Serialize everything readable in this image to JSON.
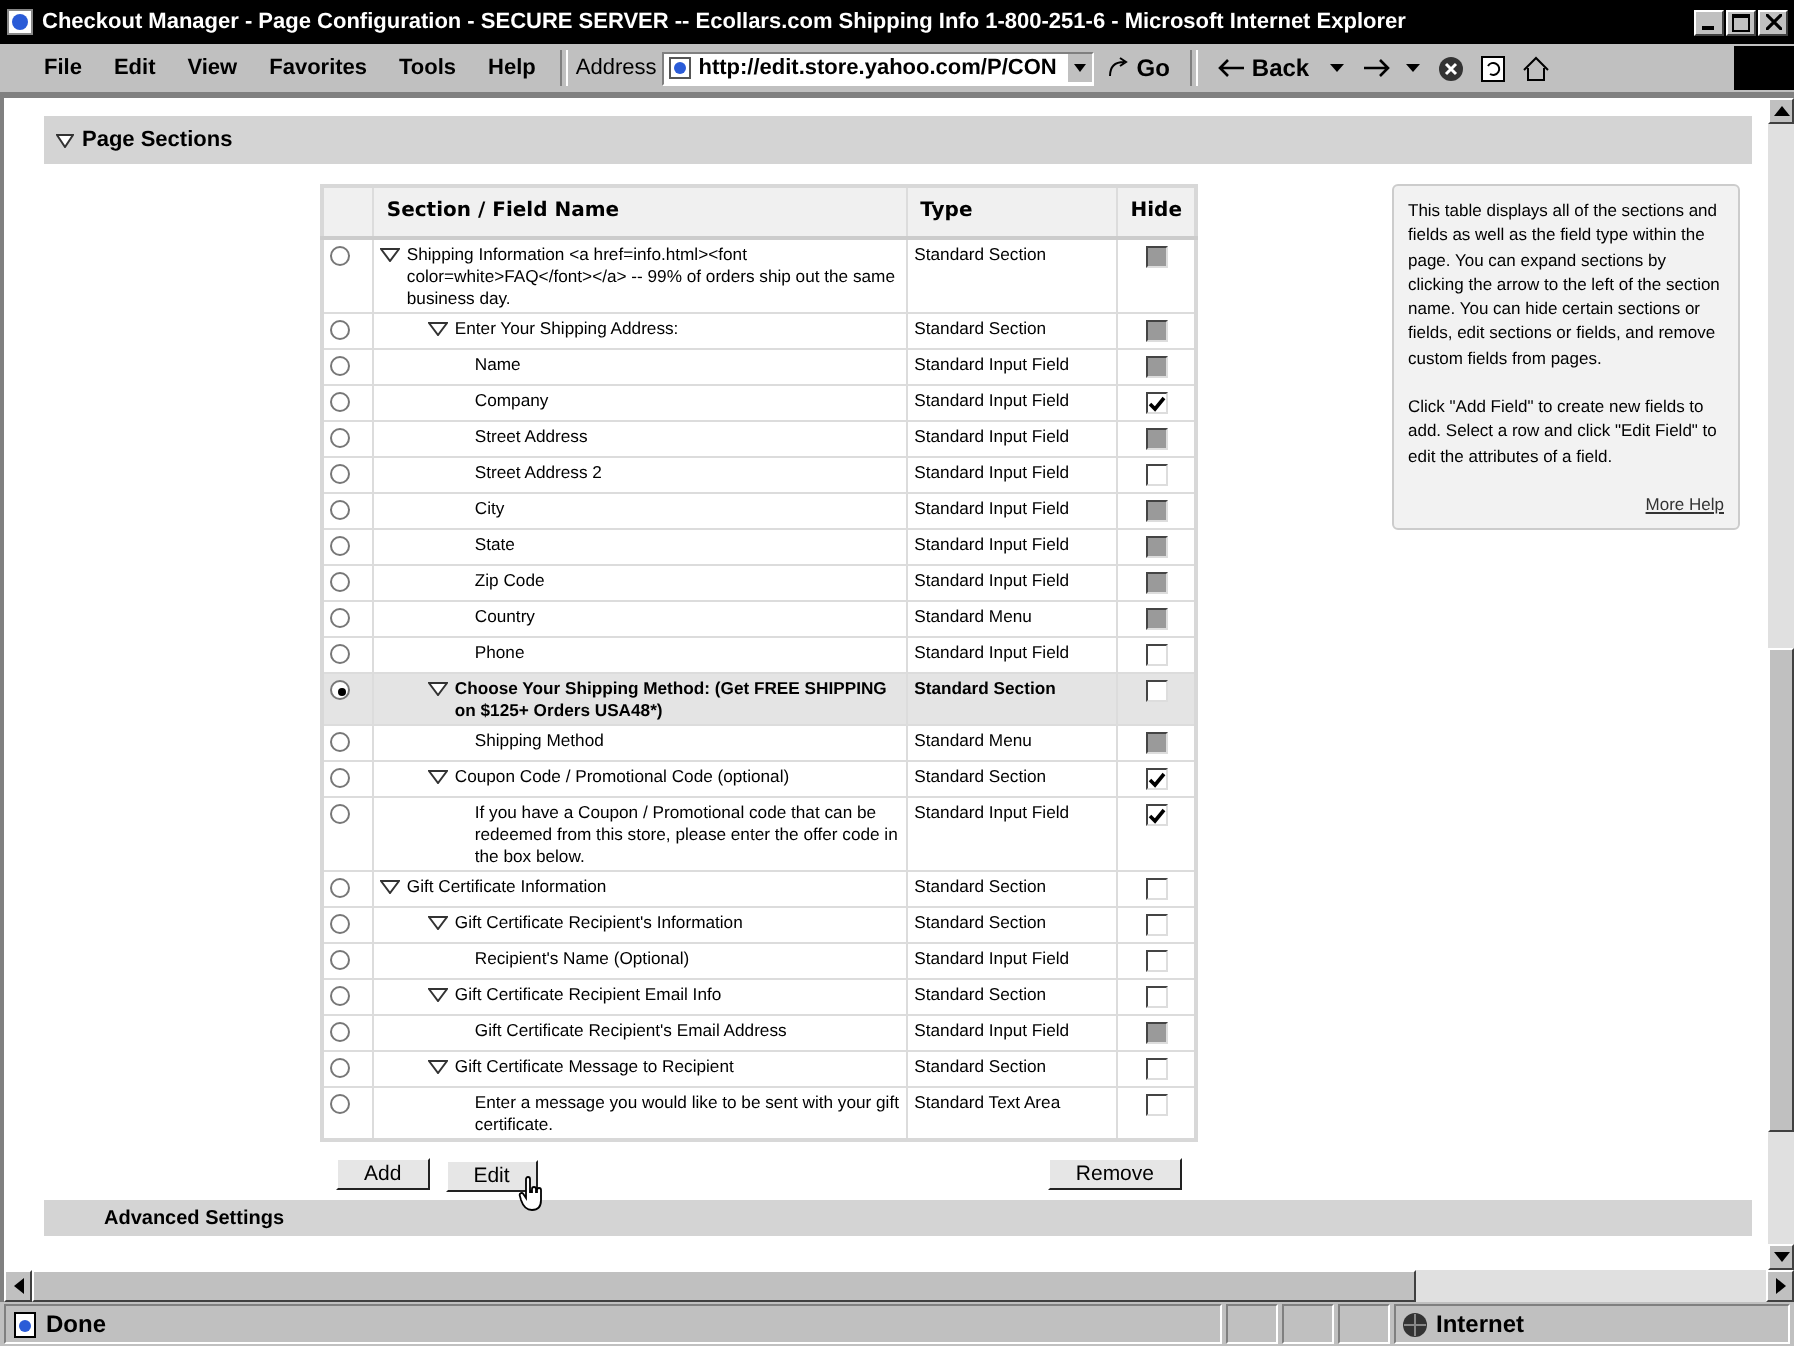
{
  "window": {
    "title": "Checkout Manager - Page Configuration - SECURE SERVER -- Ecollars.com Shipping Info 1-800-251-6 - Microsoft Internet Explorer"
  },
  "menu": [
    "File",
    "Edit",
    "View",
    "Favorites",
    "Tools",
    "Help"
  ],
  "address": {
    "label": "Address",
    "value": "http://edit.store.yahoo.com/P/CON"
  },
  "toolbar": {
    "go": "Go",
    "back": "Back"
  },
  "page_sections": {
    "title": "Page Sections",
    "expanded": true
  },
  "table": {
    "columns": [
      "Section / Field Name",
      "Type",
      "Hide"
    ],
    "rows": [
      {
        "name": "Shipping Information <a href=info.html><font color=white>FAQ</font></a> -- 99% of orders ship out the same business day.",
        "type": "Standard Section",
        "selected": false,
        "expanded": true,
        "hide": {
          "checked": false,
          "disabled": true
        },
        "children": [
          {
            "name": "Enter Your Shipping Address:",
            "type": "Standard Section",
            "selected": false,
            "expanded": true,
            "hide": {
              "checked": false,
              "disabled": true
            },
            "children": [
              {
                "name": "Name",
                "type": "Standard Input Field",
                "selected": false,
                "hide": {
                  "checked": false,
                  "disabled": true
                }
              },
              {
                "name": "Company",
                "type": "Standard Input Field",
                "selected": false,
                "hide": {
                  "checked": true,
                  "disabled": false
                }
              },
              {
                "name": "Street Address",
                "type": "Standard Input Field",
                "selected": false,
                "hide": {
                  "checked": false,
                  "disabled": true
                }
              },
              {
                "name": "Street Address 2",
                "type": "Standard Input Field",
                "selected": false,
                "hide": {
                  "checked": false,
                  "disabled": false
                }
              },
              {
                "name": "City",
                "type": "Standard Input Field",
                "selected": false,
                "hide": {
                  "checked": false,
                  "disabled": true
                }
              },
              {
                "name": "State",
                "type": "Standard Input Field",
                "selected": false,
                "hide": {
                  "checked": false,
                  "disabled": true
                }
              },
              {
                "name": "Zip Code",
                "type": "Standard Input Field",
                "selected": false,
                "hide": {
                  "checked": false,
                  "disabled": true
                }
              },
              {
                "name": "Country",
                "type": "Standard Menu",
                "selected": false,
                "hide": {
                  "checked": false,
                  "disabled": true
                }
              },
              {
                "name": "Phone",
                "type": "Standard Input Field",
                "selected": false,
                "hide": {
                  "checked": false,
                  "disabled": false
                }
              }
            ]
          },
          {
            "name": "Choose Your Shipping Method: (Get FREE SHIPPING on $125+ Orders USA48*)",
            "type": "Standard Section",
            "selected": true,
            "expanded": true,
            "hide": {
              "checked": false,
              "disabled": false
            },
            "children": [
              {
                "name": "Shipping Method",
                "type": "Standard Menu",
                "selected": false,
                "hide": {
                  "checked": false,
                  "disabled": true
                }
              }
            ]
          },
          {
            "name": "Coupon Code / Promotional Code (optional)",
            "type": "Standard Section",
            "selected": false,
            "expanded": true,
            "hide": {
              "checked": true,
              "disabled": false
            },
            "children": [
              {
                "name": "If you have a Coupon / Promotional code that can be redeemed from this store, please enter the offer code in the box below.",
                "type": "Standard Input Field",
                "selected": false,
                "hide": {
                  "checked": true,
                  "disabled": false
                }
              }
            ]
          }
        ]
      },
      {
        "name": "Gift Certificate Information",
        "type": "Standard Section",
        "selected": false,
        "expanded": true,
        "hide": {
          "checked": false,
          "disabled": false
        },
        "children": [
          {
            "name": "Gift Certificate Recipient's Information",
            "type": "Standard Section",
            "selected": false,
            "expanded": true,
            "hide": {
              "checked": false,
              "disabled": false
            },
            "children": [
              {
                "name": "Recipient's Name (Optional)",
                "type": "Standard Input Field",
                "selected": false,
                "hide": {
                  "checked": false,
                  "disabled": false
                }
              }
            ]
          },
          {
            "name": "Gift Certificate Recipient Email Info",
            "type": "Standard Section",
            "selected": false,
            "expanded": true,
            "hide": {
              "checked": false,
              "disabled": false
            },
            "children": [
              {
                "name": "Gift Certificate Recipient's Email Address",
                "type": "Standard Input Field",
                "selected": false,
                "hide": {
                  "checked": false,
                  "disabled": true
                }
              }
            ]
          },
          {
            "name": "Gift Certificate Message to Recipient",
            "type": "Standard Section",
            "selected": false,
            "expanded": true,
            "hide": {
              "checked": false,
              "disabled": false
            },
            "children": [
              {
                "name": "Enter a message you would like to be sent with your gift certificate.",
                "type": "Standard Text Area",
                "selected": false,
                "hide": {
                  "checked": false,
                  "disabled": false
                }
              }
            ]
          }
        ]
      }
    ]
  },
  "help": {
    "paragraphs": [
      "This table displays all of the sections and fields as well as the field type within the page. You can expand sections by clicking the arrow to the left of the section name. You can hide certain sections or fields, edit sections or fields, and remove custom fields from pages.",
      "Click \"Add Field\" to create new fields to add. Select a row and click \"Edit Field\" to edit the attributes of a field."
    ],
    "link": "More Help"
  },
  "buttons": [
    "Add",
    "Edit",
    "Remove"
  ],
  "advanced_settings": {
    "title": "Advanced Settings"
  },
  "status_bar": {
    "text": "Done",
    "zone": "Internet"
  }
}
